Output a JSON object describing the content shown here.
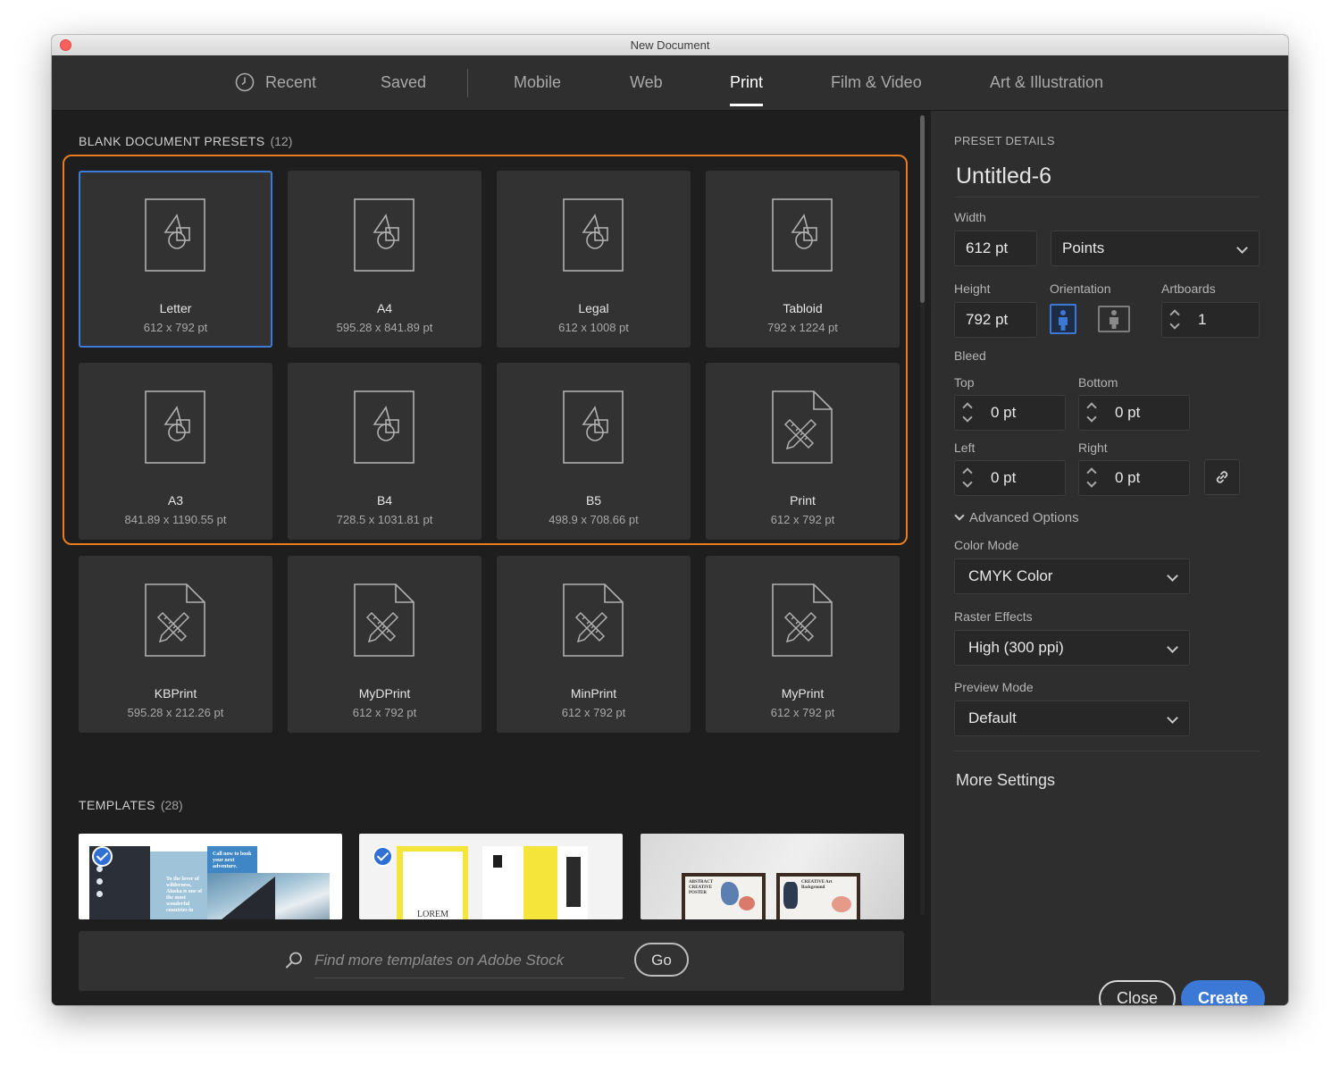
{
  "window": {
    "title": "New Document"
  },
  "tabs": [
    {
      "label": "Recent"
    },
    {
      "label": "Saved"
    },
    {
      "label": "Mobile"
    },
    {
      "label": "Web"
    },
    {
      "label": "Print"
    },
    {
      "label": "Film & Video"
    },
    {
      "label": "Art & Illustration"
    }
  ],
  "active_tab": "Print",
  "presets": {
    "title": "BLANK DOCUMENT PRESETS",
    "count": "(12)",
    "items": [
      {
        "name": "Letter",
        "size": "612 x 792 pt",
        "icon": "shapes-doc-icon"
      },
      {
        "name": "A4",
        "size": "595.28 x 841.89 pt",
        "icon": "shapes-doc-icon"
      },
      {
        "name": "Legal",
        "size": "612 x 1008 pt",
        "icon": "shapes-doc-icon"
      },
      {
        "name": "Tabloid",
        "size": "792 x 1224 pt",
        "icon": "shapes-doc-icon"
      },
      {
        "name": "A3",
        "size": "841.89 x 1190.55 pt",
        "icon": "shapes-doc-icon"
      },
      {
        "name": "B4",
        "size": "728.5 x 1031.81 pt",
        "icon": "shapes-doc-icon"
      },
      {
        "name": "B5",
        "size": "498.9 x 708.66 pt",
        "icon": "shapes-doc-icon"
      },
      {
        "name": "Print",
        "size": "612 x 792 pt",
        "icon": "pencil-ruler-doc-icon"
      },
      {
        "name": "KBPrint",
        "size": "595.28 x 212.26 pt",
        "icon": "pencil-ruler-doc-icon"
      },
      {
        "name": "MyDPrint",
        "size": "612 x 792 pt",
        "icon": "pencil-ruler-doc-icon"
      },
      {
        "name": "MinPrint",
        "size": "612 x 792 pt",
        "icon": "pencil-ruler-doc-icon"
      },
      {
        "name": "MyPrint",
        "size": "612 x 792 pt",
        "icon": "pencil-ruler-doc-icon"
      }
    ]
  },
  "templates": {
    "title": "TEMPLATES",
    "count": "(28)",
    "items": [
      {
        "texts": [
          "Call now to book your next adventure.",
          "To the lover of wilderness, Alaska is one of the most wonderful countries in"
        ]
      },
      {
        "texts": [
          "LOREM"
        ]
      },
      {
        "texts": [
          "ABSTRACT CREATIVE POSTER",
          "CREATIVE Art Background"
        ]
      }
    ],
    "search_placeholder": "Find more templates on Adobe Stock",
    "go_label": "Go"
  },
  "details": {
    "section_title": "PRESET DETAILS",
    "doc_name": "Untitled-6",
    "width_label": "Width",
    "width_value": "612 pt",
    "units_value": "Points",
    "height_label": "Height",
    "height_value": "792 pt",
    "orientation_label": "Orientation",
    "artboards_label": "Artboards",
    "artboards_value": "1",
    "bleed_label": "Bleed",
    "top_label": "Top",
    "top_value": "0 pt",
    "bottom_label": "Bottom",
    "bottom_value": "0 pt",
    "left_label": "Left",
    "left_value": "0 pt",
    "right_label": "Right",
    "right_value": "0 pt",
    "advanced_label": "Advanced Options",
    "color_mode_label": "Color Mode",
    "color_mode_value": "CMYK Color",
    "raster_label": "Raster Effects",
    "raster_value": "High (300 ppi)",
    "preview_label": "Preview Mode",
    "preview_value": "Default",
    "more_settings": "More Settings",
    "close_label": "Close",
    "create_label": "Create"
  },
  "colors": {
    "accent": "#3c79d6",
    "highlight": "#ea7d1f",
    "panel": "#2e2e2e"
  }
}
